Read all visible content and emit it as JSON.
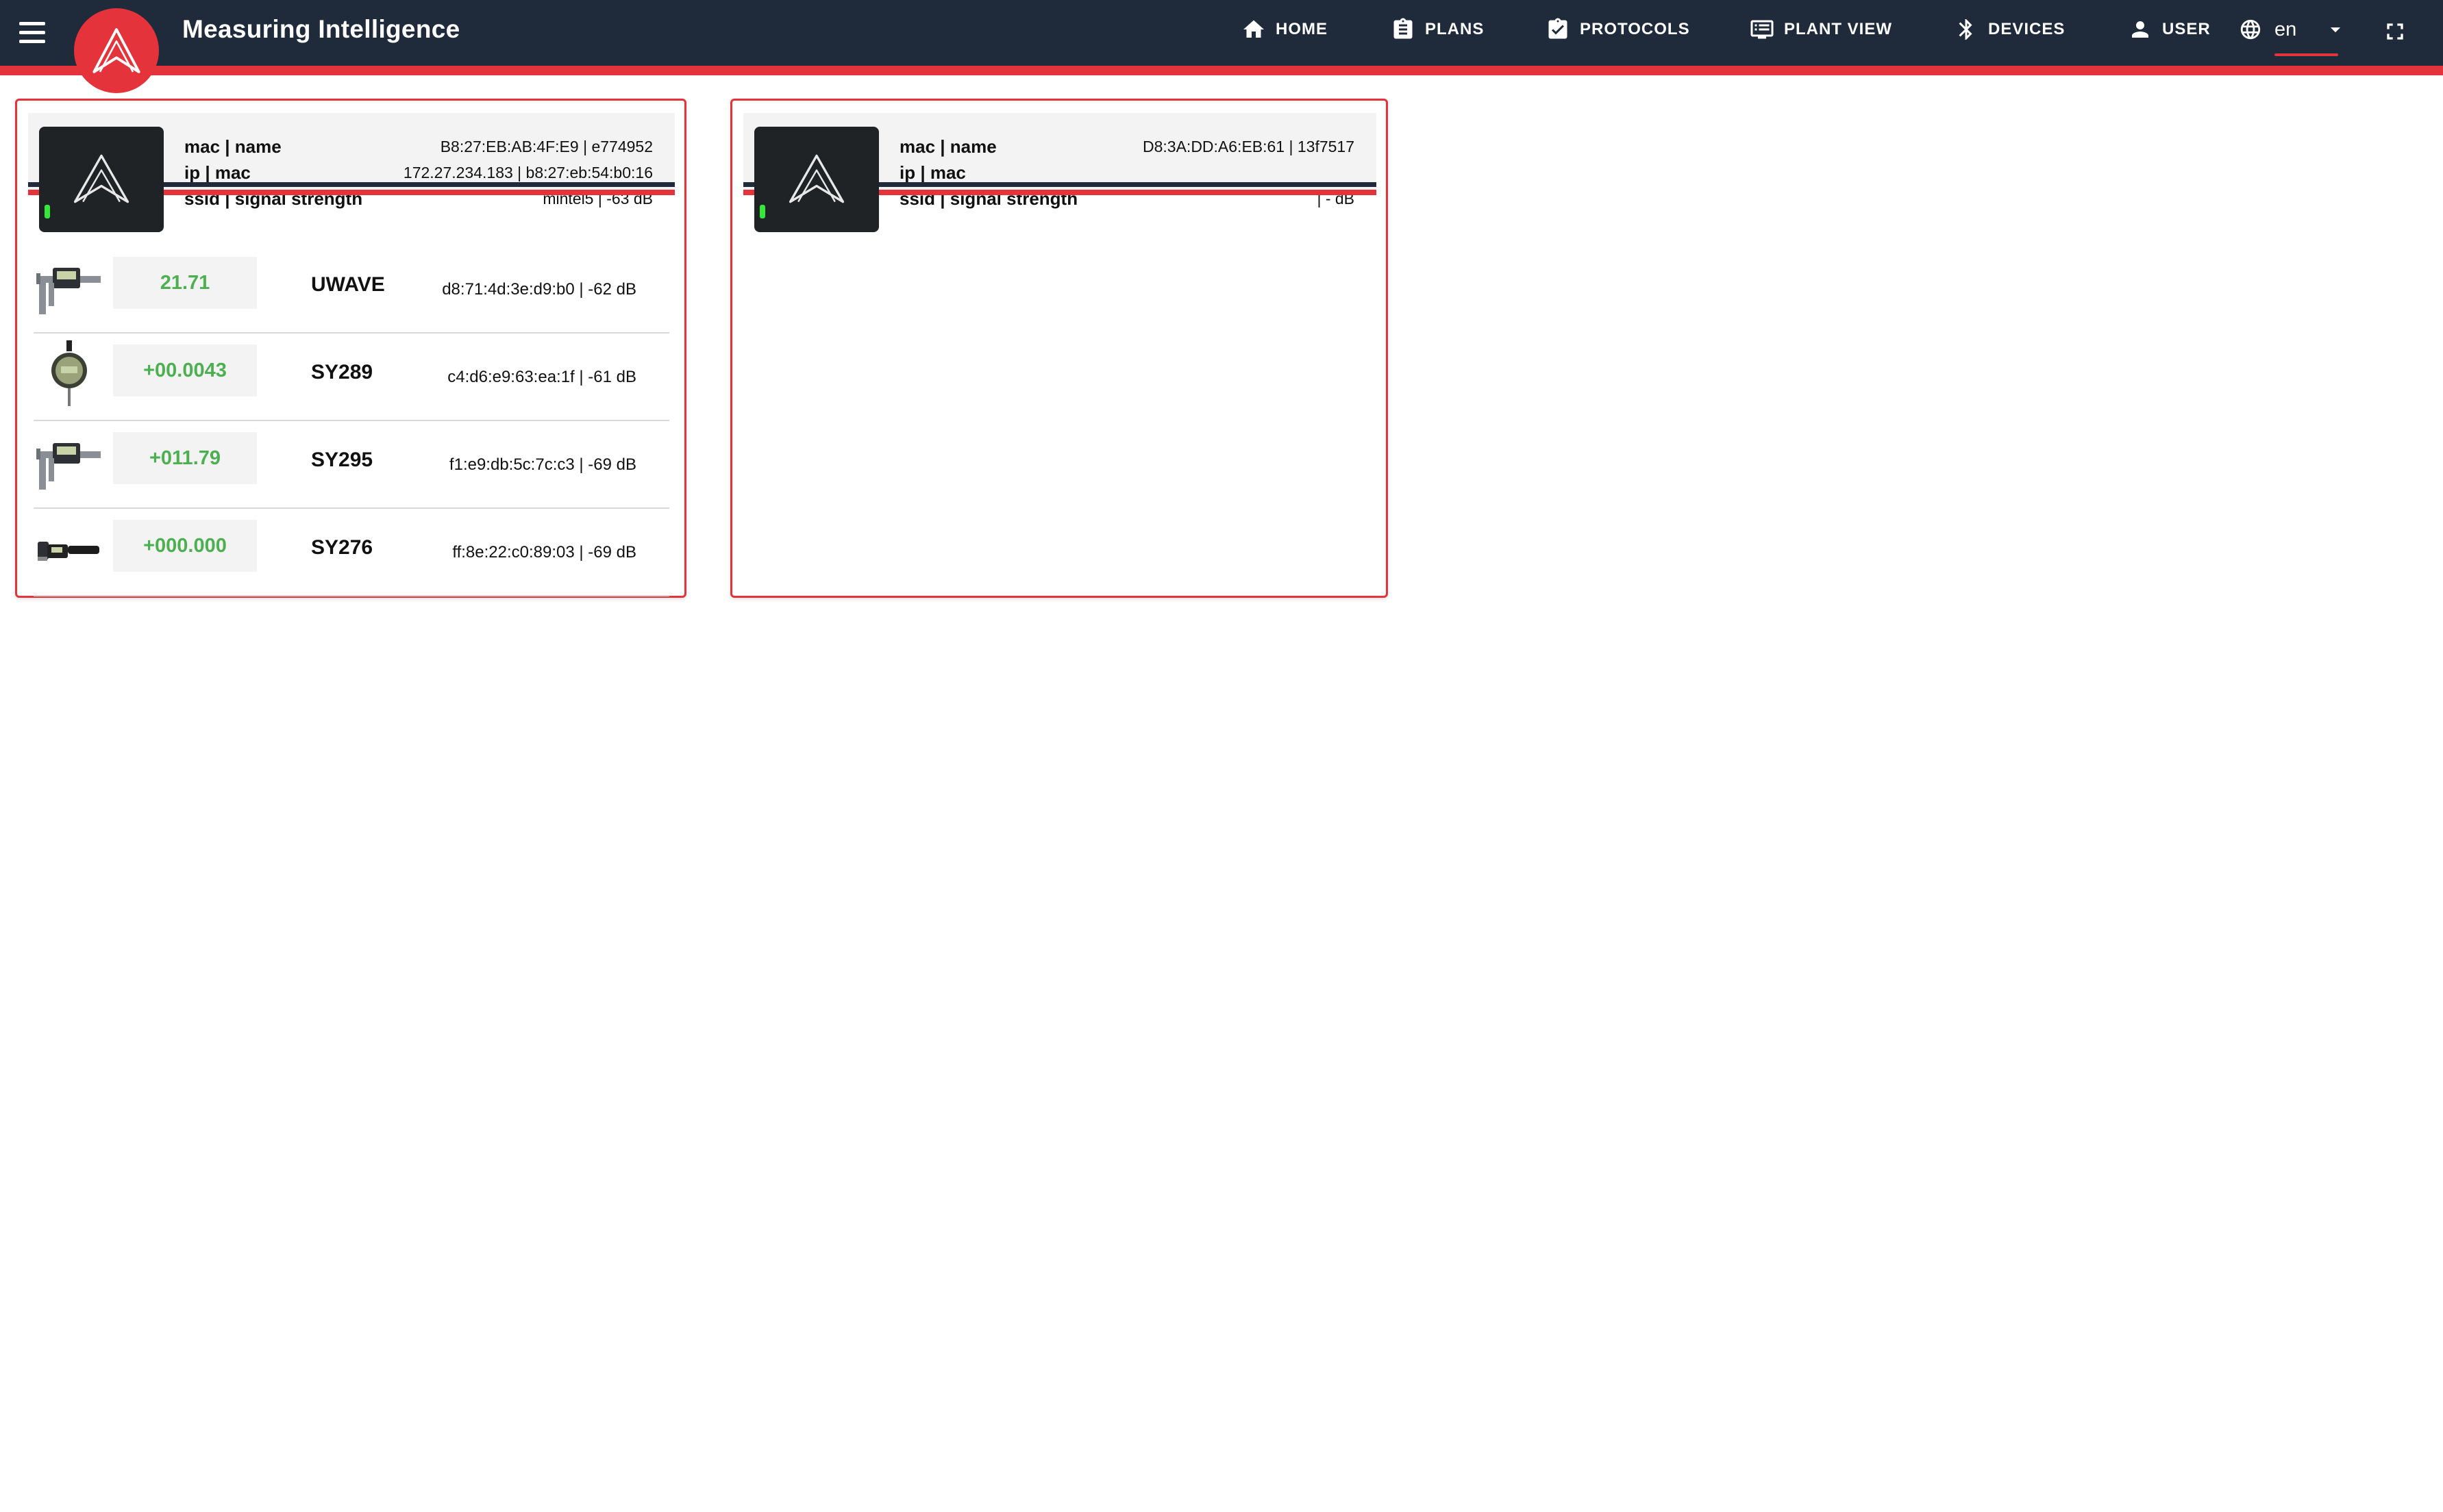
{
  "app": {
    "title": "Measuring Intelligence"
  },
  "nav": {
    "home": {
      "label": "HOME",
      "icon": "home-icon"
    },
    "plans": {
      "label": "PLANS",
      "icon": "clipboard-icon"
    },
    "protocols": {
      "label": "PROTOCOLS",
      "icon": "clipboard-check-icon"
    },
    "plant_view": {
      "label": "PLANT VIEW",
      "icon": "monitor-list-icon"
    },
    "devices": {
      "label": "DEVICES",
      "icon": "bluetooth-icon"
    },
    "user": {
      "label": "USER",
      "icon": "person-icon"
    }
  },
  "language": {
    "selected": "en",
    "icon": "globe-icon"
  },
  "colors": {
    "topbar": "#1f2a3a",
    "accent": "#e5333b",
    "value_green": "#4caf50",
    "led_green": "#34e83a"
  },
  "gateways": [
    {
      "labels": {
        "row1": "mac | name",
        "row2": "ip | mac",
        "row3": "ssid | signal strength"
      },
      "values": {
        "row1": "B8:27:EB:AB:4F:E9 | e774952",
        "row2": "172.27.234.183 | b8:27:eb:54:b0:16",
        "row3": "mintel5 | -63 dB"
      },
      "devices": [
        {
          "icon": "caliper-icon",
          "value": "21.71",
          "name": "UWAVE",
          "info": "d8:71:4d:3e:d9:b0 | -62 dB"
        },
        {
          "icon": "dial-indicator-icon",
          "value": "+00.0043",
          "name": "SY289",
          "info": "c4:d6:e9:63:ea:1f | -61 dB"
        },
        {
          "icon": "caliper-icon",
          "value": "+011.79",
          "name": "SY295",
          "info": "f1:e9:db:5c:7c:c3 | -69 dB"
        },
        {
          "icon": "micrometer-icon",
          "value": "+000.000",
          "name": "SY276",
          "info": "ff:8e:22:c0:89:03 | -69 dB"
        }
      ]
    },
    {
      "labels": {
        "row1": "mac | name",
        "row2": "ip | mac",
        "row3": "ssid | signal strength"
      },
      "values": {
        "row1": "D8:3A:DD:A6:EB:61 | 13f7517",
        "row2": "",
        "row3": "| - dB"
      },
      "devices": []
    }
  ]
}
